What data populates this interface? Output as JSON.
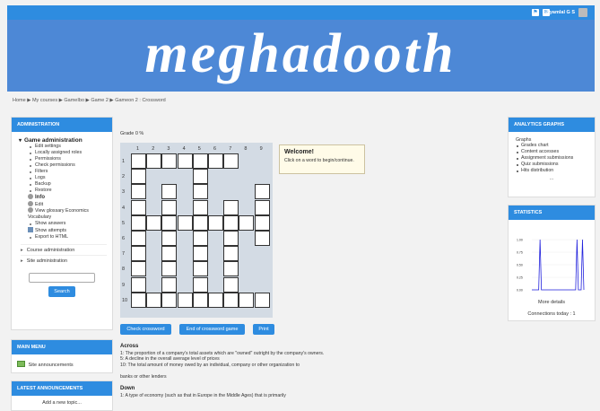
{
  "topbar": {
    "user": "Syamlal G S"
  },
  "banner": {
    "logo_text": "meghadooth"
  },
  "breadcrumb": {
    "items": [
      "Home",
      "My courses",
      "GameIbo",
      "Game 2",
      "Gameon 2 : Crossword"
    ],
    "separator": "▶"
  },
  "admin": {
    "title": "ADMINISTRATION",
    "root": "Game administration",
    "items": [
      "Edit settings",
      "Locally assigned roles",
      "Permissions",
      "Check permissions",
      "Filters",
      "Logs",
      "Backup",
      "Restore"
    ],
    "info": "Info",
    "edit": "Edit",
    "glossary": "View glossary Economics Vocabulary",
    "show_answers": "Show answers",
    "show_attempts": "Show attempts",
    "export": "Export to HTML",
    "course_admin": "Course administration",
    "site_admin": "Site administration",
    "search_button": "Search"
  },
  "main_menu": {
    "title": "MAIN MENU",
    "item": "Site announcements"
  },
  "latest": {
    "title": "LATEST ANNOUNCEMENTS",
    "add": "Add a new topic..."
  },
  "analytics": {
    "title": "ANALYTICS GRAPHS",
    "label": "Graphs",
    "items": [
      "Grades chart",
      "Content accesses",
      "Assignment submissions",
      "Quiz submissions",
      "Hits distribution"
    ],
    "more": "..."
  },
  "statistics": {
    "title": "STATISTICS",
    "more": "More details",
    "connections": "Connections today : 1",
    "chart_data": {
      "type": "line",
      "y_ticks": [
        "1.00",
        "0.75",
        "0.50",
        "0.25",
        "0.00"
      ],
      "ylim": [
        0,
        1
      ],
      "values": [
        0,
        0,
        0,
        0,
        0,
        0,
        1,
        0,
        0,
        0,
        0,
        0,
        0,
        0,
        0,
        0,
        0,
        0,
        0,
        0,
        0,
        0,
        0,
        0,
        0,
        0,
        0,
        0,
        0,
        0,
        0,
        0,
        0,
        1,
        0,
        0,
        0,
        1,
        0
      ]
    }
  },
  "game": {
    "grade": "Grade 0 %",
    "col_numbers": [
      "1",
      "2",
      "3",
      "4",
      "5",
      "6",
      "7",
      "8",
      "9"
    ],
    "row_numbers": [
      "1",
      "2",
      "3",
      "4",
      "5",
      "6",
      "7",
      "8",
      "9",
      "10"
    ],
    "welcome_title": "Welcome!",
    "welcome_text": "Click on a word to begin/continue.",
    "check_button": "Check crossword",
    "end_button": "End of crossword game",
    "print_button": "Print"
  },
  "clues": {
    "across_title": "Across",
    "across": [
      "1: The proportion of a company's total assets which are \"owned\" outright by the company's owners.",
      "5: A decline in the overall average level of prices",
      "10: The total amount of money owed by an individual, company or other organization to",
      "",
      "banks or other lenders"
    ],
    "down_title": "Down",
    "down": [
      "1: A type of economy (such as that in Europe in the Middle Ages) that is primarily"
    ]
  }
}
